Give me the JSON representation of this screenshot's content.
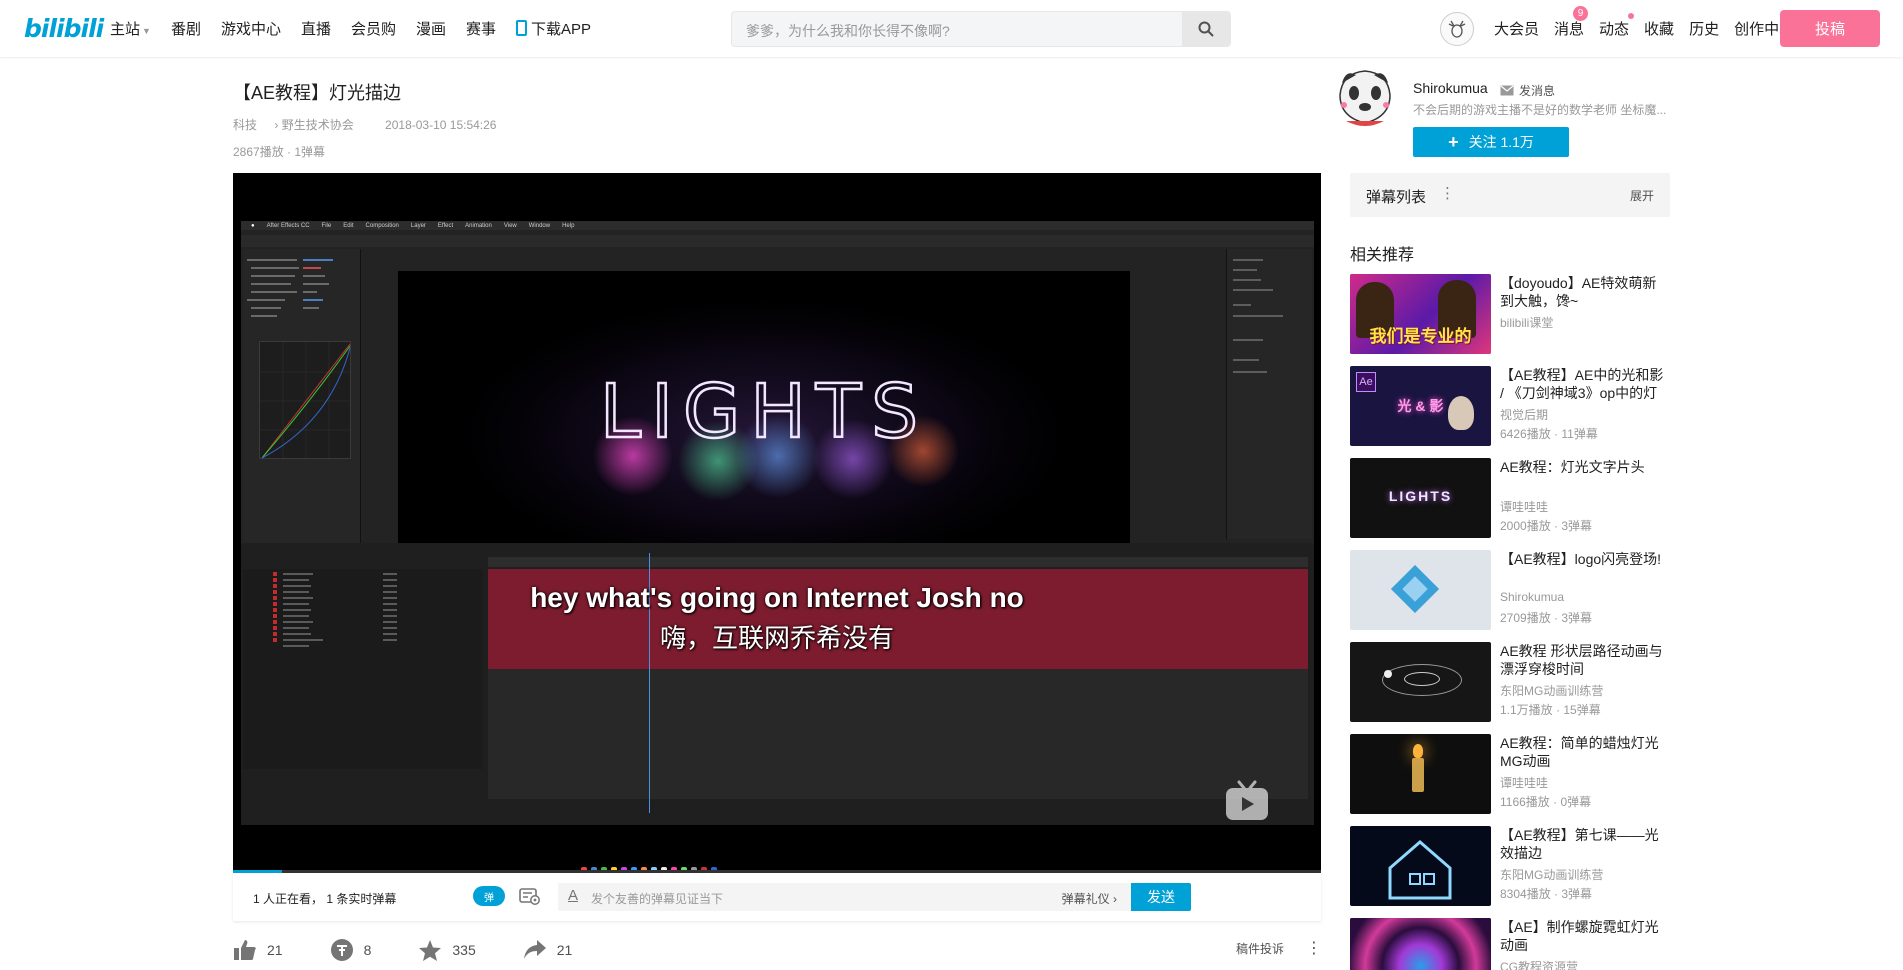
{
  "header": {
    "logo": "bilibili",
    "nav": [
      "主站",
      "番剧",
      "游戏中心",
      "直播",
      "会员购",
      "漫画",
      "赛事"
    ],
    "download": "下载APP",
    "search_placeholder": "爹爹，为什么我和你长得不像啊?",
    "right": {
      "vip": "大会员",
      "messages": "消息",
      "messages_badge": "9",
      "dynamics": "动态",
      "favorites": "收藏",
      "history": "历史",
      "creator": "创作中心"
    },
    "upload": "投稿"
  },
  "video": {
    "title": "【AE教程】灯光描边",
    "category": "科技",
    "subcategory": "野生技术协会",
    "date": "2018-03-10 15:54:26",
    "stats": "2867播放 · 1弹幕",
    "subtitle_en": "hey what's going on Internet Josh no",
    "subtitle_cn": "嗨，互联网乔希没有",
    "screen_text": "LIGHTS",
    "progress_fraction": 0.045
  },
  "danmaku_bar": {
    "watching": "1 人正在看， 1 条实时弹幕",
    "toggle": "弹",
    "placeholder": "发个友善的弹幕见证当下",
    "etiquette": "弹幕礼仪 ›",
    "send": "发送"
  },
  "actions": {
    "like": "21",
    "coin": "8",
    "favorite": "335",
    "share": "21",
    "report": "稿件投诉"
  },
  "uploader": {
    "name": "Shirokumua",
    "message": "发消息",
    "desc": "不会后期的游戏主播不是好的数学老师 坐标魔...",
    "follow": "关注 1.1万"
  },
  "danmaku_list": {
    "title": "弹幕列表",
    "expand": "展开"
  },
  "related": {
    "title": "相关推荐",
    "items": [
      {
        "title": "【doyoudo】AE特效萌新到大触，馋~",
        "uploader": "bilibili课堂",
        "stats": "",
        "thumb_text": "我们是专业的",
        "bg": "#b5196e"
      },
      {
        "title": "【AE教程】AE中的光和影 / 《刀剑神域3》op中的灯",
        "uploader": "视觉后期",
        "stats": "6426播放 · 11弹幕",
        "thumb_text": "光 & 影",
        "bg": "#1a1440"
      },
      {
        "title": "AE教程：灯光文字片头",
        "uploader": "谭哇哇哇",
        "stats": "2000播放 · 3弹幕",
        "thumb_text": "LIGHTS",
        "bg": "#111111"
      },
      {
        "title": "【AE教程】logo闪亮登场!",
        "uploader": "Shirokumua",
        "stats": "2709播放 · 3弹幕",
        "thumb_text": "",
        "bg": "#dfe4ea"
      },
      {
        "title": "AE教程 形状层路径动画与漂浮穿梭时间",
        "uploader": "东阳MG动画训练营",
        "stats": "1.1万播放 · 15弹幕",
        "thumb_text": "",
        "bg": "#161616"
      },
      {
        "title": "AE教程：简单的蜡烛灯光MG动画",
        "uploader": "谭哇哇哇",
        "stats": "1166播放 · 0弹幕",
        "thumb_text": "",
        "bg": "#0e0e0e"
      },
      {
        "title": "【AE教程】第七课——光效描边",
        "uploader": "东阳MG动画训练营",
        "stats": "8304播放 · 3弹幕",
        "thumb_text": "",
        "bg": "#050a1a"
      },
      {
        "title": "【AE】制作螺旋霓虹灯光动画",
        "uploader": "CG教程资源营",
        "stats": "",
        "thumb_text": "",
        "bg": "#2a0d3d"
      }
    ]
  }
}
